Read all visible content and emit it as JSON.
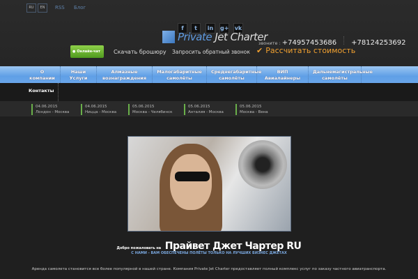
{
  "top": {
    "lang": [
      "RU",
      "EN"
    ],
    "links": [
      "RSS",
      "Блог"
    ]
  },
  "social": [
    "f",
    "t",
    "in",
    "g+",
    "vk"
  ],
  "logo": {
    "a": "Private",
    "b": "Jet Charter"
  },
  "phones": {
    "label": "звоните :",
    "p1": "+74957453686",
    "p2": "+78124253692"
  },
  "actions": {
    "chat": "Онлайн-чат",
    "brochure": "Скачать брошюру",
    "callback": "Запросить обратный звонок",
    "calc": "Рассчитать стоимость"
  },
  "nav": [
    "О компании",
    "Наши Услуги",
    "Алмазные вознаграждения",
    "Малогабаритные самолёты",
    "Среднегабаритные самолёты",
    "ВИП Авиалайнеры",
    "Дальнемагистральные самолёты",
    "Контакты"
  ],
  "flights": [
    {
      "date": "04.06.2015",
      "route": "Лондон - Москва"
    },
    {
      "date": "04.06.2015",
      "route": "Ницца - Москва"
    },
    {
      "date": "05.06.2015",
      "route": "Москва - Челябинск"
    },
    {
      "date": "05.06.2015",
      "route": "Анталия - Москва"
    },
    {
      "date": "05.06.2015",
      "route": "Москва - Вена"
    }
  ],
  "welcome": {
    "small": "Добро пожаловать на",
    "big": "Прайвет Джет Чартер RU",
    "sub": "С НАМИ - ВАМ ОБЕСПЕЧЕНЫ ПОЛЁТЫ ТОЛЬКО НА ЛУЧШИХ БИЗНЕС ДЖЕТАХ",
    "para": "Аренда самолета становится все более популярной в нашей стране. Компания Private Jet Charter предоставляет полный комплекс услуг по заказу частного авиатранспорта."
  }
}
